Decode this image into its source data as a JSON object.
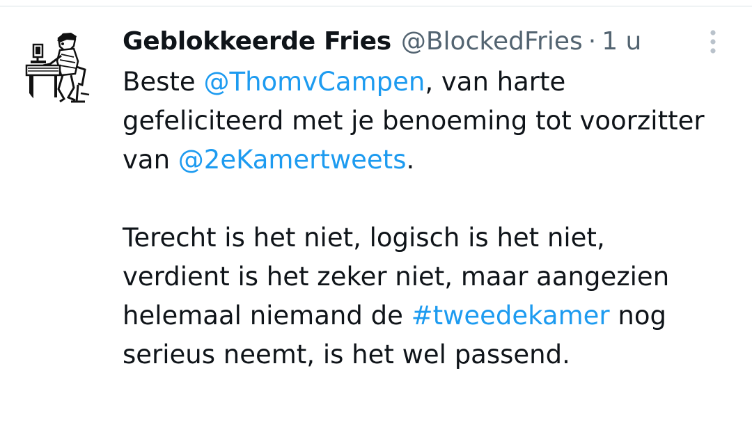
{
  "author": {
    "display_name": "Geblokkeerde Fries",
    "handle": "@BlockedFries",
    "separator": "·",
    "time": "1 u"
  },
  "menu": {
    "icon": "more-vertical-icon"
  },
  "avatar": {
    "icon": "person-at-desk-illustration"
  },
  "tweet": {
    "p1_l1_pre": "Beste ",
    "p1_l1_mention": "@ThomvCampen",
    "p1_l1_post": ", van harte",
    "p1_l2": "gefeliciteerd met je benoeming tot voorzitter",
    "p1_l3_pre": "van ",
    "p1_l3_mention": "@2eKamertweets",
    "p1_l3_post": ".",
    "p2_l1": "Terecht is het niet, logisch is het niet,",
    "p2_l2": "verdient is het zeker niet, maar aangezien",
    "p2_l3_pre": "helemaal niemand de ",
    "p2_l3_hashtag": "#tweedekamer",
    "p2_l3_post": " nog",
    "p2_l4": "serieus neemt, is het wel passend."
  },
  "colors": {
    "link": "#1d9bf0",
    "secondary_text": "#536471",
    "primary_text": "#0f1419",
    "divider": "#eff3f4"
  }
}
